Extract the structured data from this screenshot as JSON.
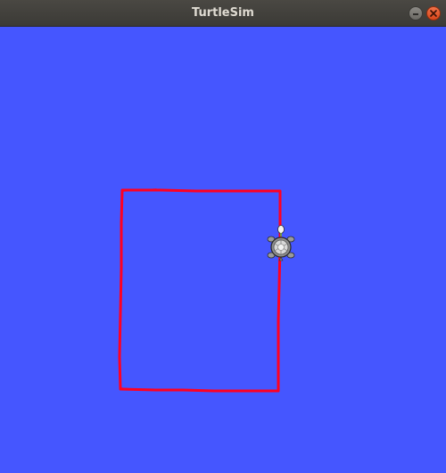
{
  "window": {
    "title": "TurtleSim",
    "buttons": [
      "minimize",
      "close"
    ]
  },
  "canvas": {
    "background_color": "#4556ff",
    "pen_color": "#ff0022",
    "turtle": {
      "icon": "turtle-icon",
      "heading": "up"
    }
  }
}
